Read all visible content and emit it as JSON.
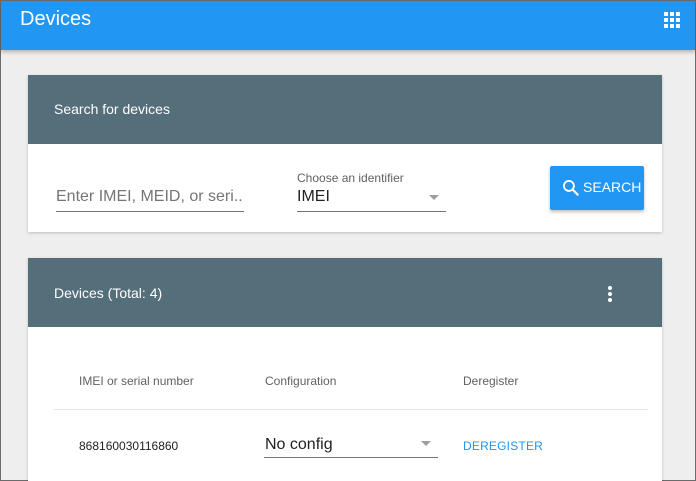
{
  "topbar": {
    "title": "Devices",
    "apps_icon": "apps-grid-icon",
    "color": "#2196f3"
  },
  "search_card": {
    "header_title": "Search for devices",
    "input_placeholder": "Enter IMEI, MEID, or seri...",
    "input_value": "",
    "identifier_label": "Choose an identifier",
    "identifier_value": "IMEI",
    "search_button_label": "SEARCH",
    "search_icon": "search-icon"
  },
  "devices_card": {
    "header_title": "Devices (Total: 4)",
    "more_icon": "more-vert-icon",
    "columns": [
      "IMEI or serial number",
      "Configuration",
      "Deregister"
    ],
    "rows": [
      {
        "imei": "868160030116860",
        "configuration": "No config",
        "deregister": "DEREGISTER"
      }
    ]
  },
  "colors": {
    "header_bg": "#546e7a",
    "accent": "#2196f3",
    "page_bg": "#eeeeee"
  }
}
